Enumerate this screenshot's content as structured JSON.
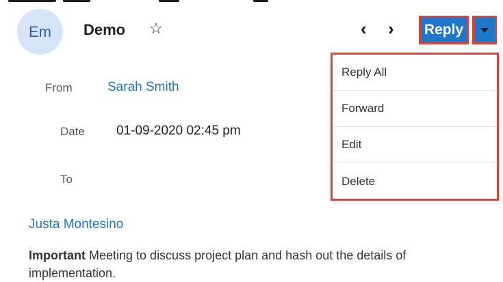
{
  "header": {
    "avatar_initials": "Em",
    "title": "Demo",
    "favorite_icon": "star-outline-icon",
    "prev_glyph": "‹",
    "next_glyph": "›",
    "reply_label": "Reply"
  },
  "reply_menu": {
    "items": [
      "Reply All",
      "Forward",
      "Edit",
      "Delete"
    ]
  },
  "fields": {
    "from_label": "From",
    "from_value": "Sarah Smith",
    "date_label": "Date",
    "date_value": "01-09-2020 02:45 pm",
    "to_label": "To",
    "to_value": "Justa Montesino"
  },
  "message": {
    "emphasis": "Important",
    "text": " Meeting to discuss project plan and hash out the details of implementation."
  },
  "colors": {
    "accent": "#1e77c9",
    "highlight_border": "#d9443a",
    "avatar_bg": "#d6e4fa"
  }
}
